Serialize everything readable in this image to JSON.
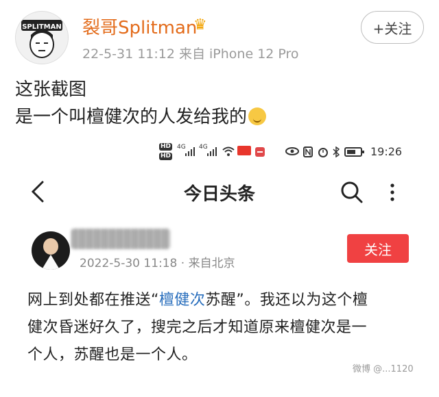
{
  "outer": {
    "username": "裂哥Splitman",
    "crown_icon": "crown-icon",
    "meta": "22-5-31 11:12  来自 iPhone 12 Pro",
    "follow": "+关注",
    "text_line1": "这张截图",
    "text_line2": "是一个叫檀健次的人发给我的",
    "avatar_text": "SPLITMAN"
  },
  "statusbar": {
    "hd1": "HD",
    "hd2": "HD",
    "sig1": "4G",
    "sig2": "4G",
    "time": "19:26"
  },
  "app": {
    "title": "今日头条",
    "back_icon": "back-arrow-icon",
    "search_icon": "search-icon",
    "more_icon": "more-vertical-icon"
  },
  "inner": {
    "meta": "2022-5-30 11:18 · 来自北京",
    "follow": "关注",
    "line1_pre": "网上到处都在推送“",
    "line1_hl": "檀健次",
    "line1_post": "苏醒”。我还以为这个檀",
    "line2": "健次昏迷好久了，搜完之后才知道原来檀健次是一",
    "line3": "个人，苏醒也是一个人。"
  },
  "watermark": "微博 @...1120",
  "colors": {
    "accent_orange": "#e36b1a",
    "follow_red": "#f04142",
    "link_blue": "#2a6fbd"
  }
}
